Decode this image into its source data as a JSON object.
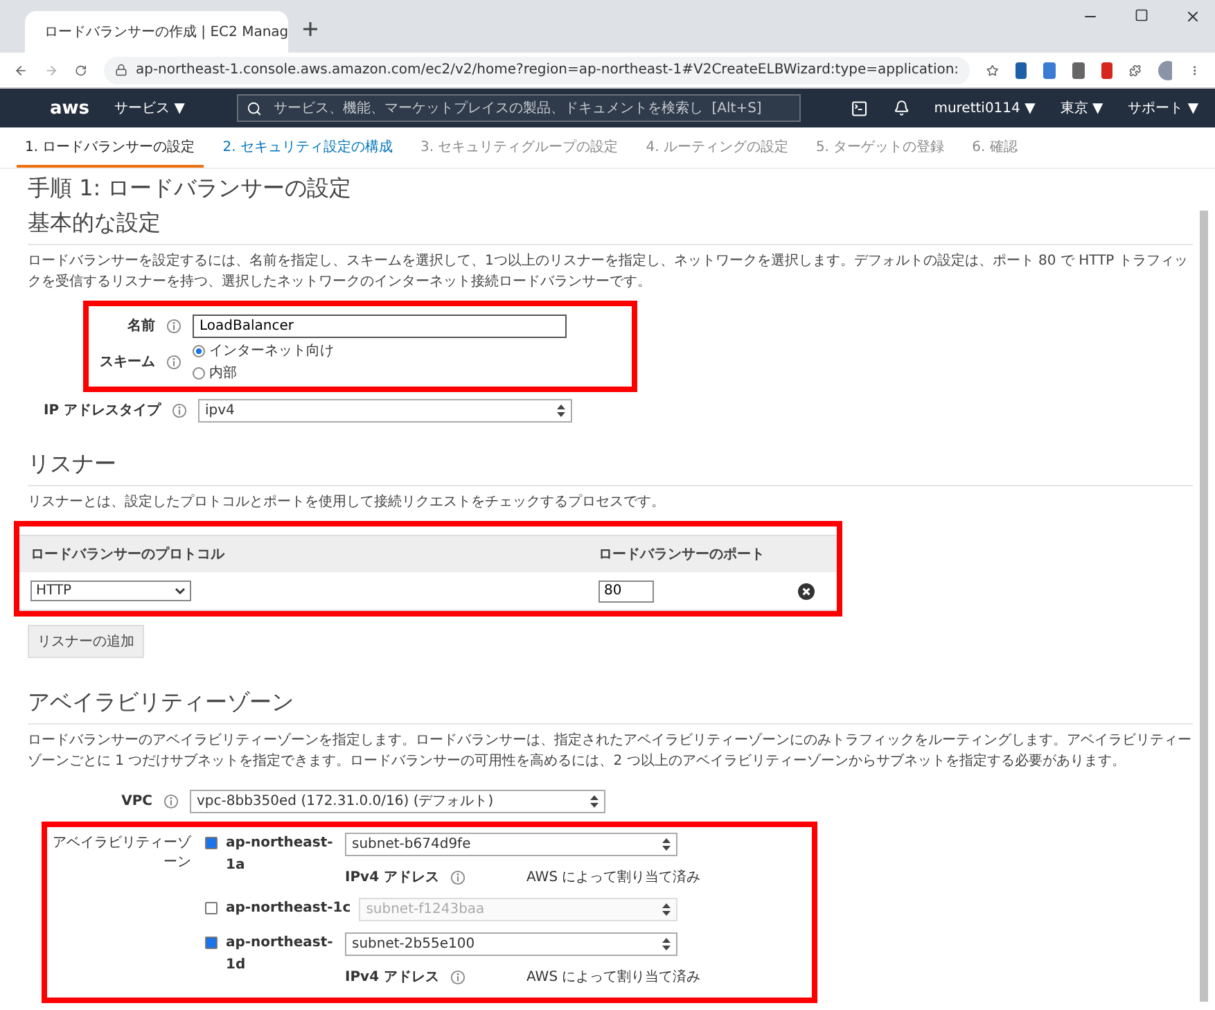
{
  "browser": {
    "tab_title": "ロードバランサーの作成 | EC2 Manag",
    "address": "ap-northeast-1.console.aws.amazon.com/ec2/v2/home?region=ap-northeast-1#V2CreateELBWizard:type=application:"
  },
  "aws_nav": {
    "logo": "aws",
    "services": "サービス ▼",
    "search_placeholder": "サービス、機能、マーケットプレイスの製品、ドキュメントを検索し  [Alt+S]",
    "user": "muretti0114 ▼",
    "region": "東京 ▼",
    "support": "サポート ▼"
  },
  "steps": [
    {
      "label": "1. ロードバランサーの設定",
      "selected": true,
      "kind": "plain"
    },
    {
      "label": "2. セキュリティ設定の構成",
      "selected": false,
      "kind": "link"
    },
    {
      "label": "3. セキュリティグループの設定",
      "selected": false,
      "kind": "plain"
    },
    {
      "label": "4. ルーティングの設定",
      "selected": false,
      "kind": "plain"
    },
    {
      "label": "5. ターゲットの登録",
      "selected": false,
      "kind": "plain"
    },
    {
      "label": "6. 確認",
      "selected": false,
      "kind": "plain"
    }
  ],
  "page_title": "手順 1: ロードバランサーの設定",
  "basic": {
    "heading": "基本的な設定",
    "description": "ロードバランサーを設定するには、名前を指定し、スキームを選択して、1つ以上のリスナーを指定し、ネットワークを選択します。デフォルトの設定は、ポート 80 で HTTP トラフィックを受信するリスナーを持つ、選択したネットワークのインターネット接続ロードバランサーです。",
    "name": {
      "label": "名前",
      "value": "LoadBalancer"
    },
    "scheme": {
      "label": "スキーム",
      "options": [
        {
          "label": "インターネット向け",
          "selected": true
        },
        {
          "label": "内部",
          "selected": false
        }
      ]
    },
    "ip_type": {
      "label": "IP アドレスタイプ",
      "value": "ipv4"
    }
  },
  "listeners": {
    "heading": "リスナー",
    "description": "リスナーとは、設定したプロトコルとポートを使用して接続リクエストをチェックするプロセスです。",
    "columns": [
      "ロードバランサーのプロトコル",
      "ロードバランサーのポート"
    ],
    "rows": [
      {
        "protocol": "HTTP",
        "port": "80"
      }
    ],
    "add_button": "リスナーの追加"
  },
  "availability": {
    "heading": "アベイラビリティーゾーン",
    "description": "ロードバランサーのアベイラビリティーゾーンを指定します。ロードバランサーは、指定されたアベイラビリティーゾーンにのみトラフィックをルーティングします。アベイラビリティーゾーンごとに 1 つだけサブネットを指定できます。ロードバランサーの可用性を高めるには、2 つ以上のアベイラビリティーゾーンからサブネットを指定する必要があります。",
    "vpc": {
      "label": "VPC",
      "value": "vpc-8bb350ed (172.31.0.0/16) (デフォルト)"
    },
    "zones_label": "アベイラビリティーゾーン",
    "zones": [
      {
        "name": "ap-northeast-1a",
        "checked": true,
        "subnet": "subnet-b674d9fe",
        "ipv4_label": "IPv4 アドレス",
        "ipv4_value": "AWS によって割り当て済み"
      },
      {
        "name": "ap-northeast-1c",
        "checked": false,
        "subnet": "subnet-f1243baa"
      },
      {
        "name": "ap-northeast-1d",
        "checked": true,
        "subnet": "subnet-2b55e100",
        "ipv4_label": "IPv4 アドレス",
        "ipv4_value": "AWS によって割り当て済み"
      }
    ]
  }
}
